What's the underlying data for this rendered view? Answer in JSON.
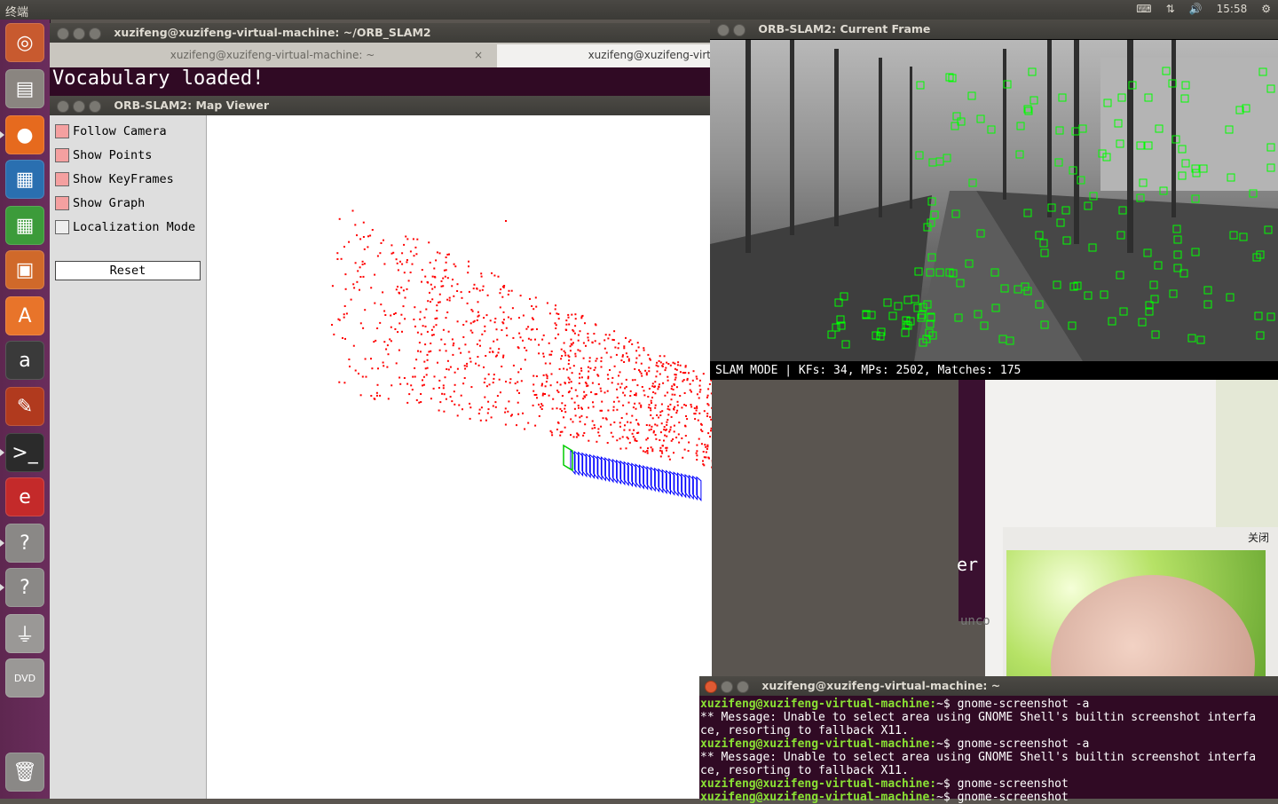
{
  "top_panel": {
    "title": "终端",
    "time": "15:58",
    "icons": [
      "keyboard-icon",
      "network-icon",
      "volume-icon",
      "gear-icon"
    ]
  },
  "launcher": {
    "items": [
      {
        "name": "ubuntu-dash",
        "glyph": "◎",
        "color": "#c85a2f"
      },
      {
        "name": "files",
        "glyph": "▤",
        "color": "#8a8580"
      },
      {
        "name": "firefox",
        "glyph": "●",
        "color": "#e66a1e"
      },
      {
        "name": "libreoffice-writer",
        "glyph": "▦",
        "color": "#2a6fb0"
      },
      {
        "name": "libreoffice-calc",
        "glyph": "▦",
        "color": "#3c9b3a"
      },
      {
        "name": "libreoffice-impress",
        "glyph": "▣",
        "color": "#d0692a"
      },
      {
        "name": "software-center",
        "glyph": "A",
        "color": "#e8742a"
      },
      {
        "name": "amazon",
        "glyph": "a",
        "color": "#3a3a3a"
      },
      {
        "name": "system-settings",
        "glyph": "✎",
        "color": "#b13a1e"
      },
      {
        "name": "terminal",
        "glyph": ">_",
        "color": "#2b2b2b"
      },
      {
        "name": "document-viewer",
        "glyph": "e",
        "color": "#c42a2a"
      },
      {
        "name": "unknown-app-1",
        "glyph": "?",
        "color": "#8a8886"
      },
      {
        "name": "unknown-app-2",
        "glyph": "?",
        "color": "#8a8886"
      },
      {
        "name": "usb-drive",
        "glyph": "⏚",
        "color": "#9a9896"
      },
      {
        "name": "dvd",
        "glyph": "DVD",
        "color": "#9a9896"
      },
      {
        "name": "trash",
        "glyph": "🗑",
        "color": "#8a8886"
      }
    ]
  },
  "terminal1": {
    "title": "xuzifeng@xuzifeng-virtual-machine: ~/ORB_SLAM2",
    "tab1": "xuzifeng@xuzifeng-virtual-machine: ~",
    "tab2": "xuzifeng@xuzifeng-virt",
    "output": "Vocabulary loaded!"
  },
  "map_viewer": {
    "title": "ORB-SLAM2: Map Viewer",
    "options": [
      {
        "label": "Follow Camera",
        "checked": true
      },
      {
        "label": "Show Points",
        "checked": true
      },
      {
        "label": "Show KeyFrames",
        "checked": true
      },
      {
        "label": "Show Graph",
        "checked": true
      },
      {
        "label": "Localization Mode",
        "checked": false
      }
    ],
    "reset_label": "Reset"
  },
  "current_frame": {
    "title": "ORB-SLAM2: Current Frame",
    "status": "SLAM MODE |  KFs: 34, MPs: 2502, Matches: 175",
    "mode": "SLAM MODE",
    "kfs": 34,
    "mps": 2502,
    "matches": 175
  },
  "background": {
    "sliver_text_1": "er",
    "sliver_text_2": "unco"
  },
  "notification": {
    "close_label": "关闭"
  },
  "terminal2": {
    "title": "xuzifeng@xuzifeng-virtual-machine: ~",
    "lines": [
      {
        "prompt": "xuzifeng@xuzifeng-virtual-machine:",
        "text": "~$ gnome-screenshot -a"
      },
      {
        "prompt": "",
        "text": "** Message: Unable to select area using GNOME Shell's builtin screenshot interfa"
      },
      {
        "prompt": "",
        "text": "ce, resorting to fallback X11."
      },
      {
        "prompt": "xuzifeng@xuzifeng-virtual-machine:",
        "text": "~$ gnome-screenshot -a"
      },
      {
        "prompt": "",
        "text": "** Message: Unable to select area using GNOME Shell's builtin screenshot interfa"
      },
      {
        "prompt": "",
        "text": "ce, resorting to fallback X11."
      },
      {
        "prompt": "xuzifeng@xuzifeng-virtual-machine:",
        "text": "~$ gnome-screenshot"
      },
      {
        "prompt": "xuzifeng@xuzifeng-virtual-machine:",
        "text": "~$ gnome-screenshot"
      }
    ]
  },
  "colors": {
    "map_points": "#ff0000",
    "keyframes": "#0000ff",
    "current_camera": "#00cc00",
    "features": "#00ff00",
    "terminal_bg": "#300a24",
    "prompt": "#8ae234"
  }
}
